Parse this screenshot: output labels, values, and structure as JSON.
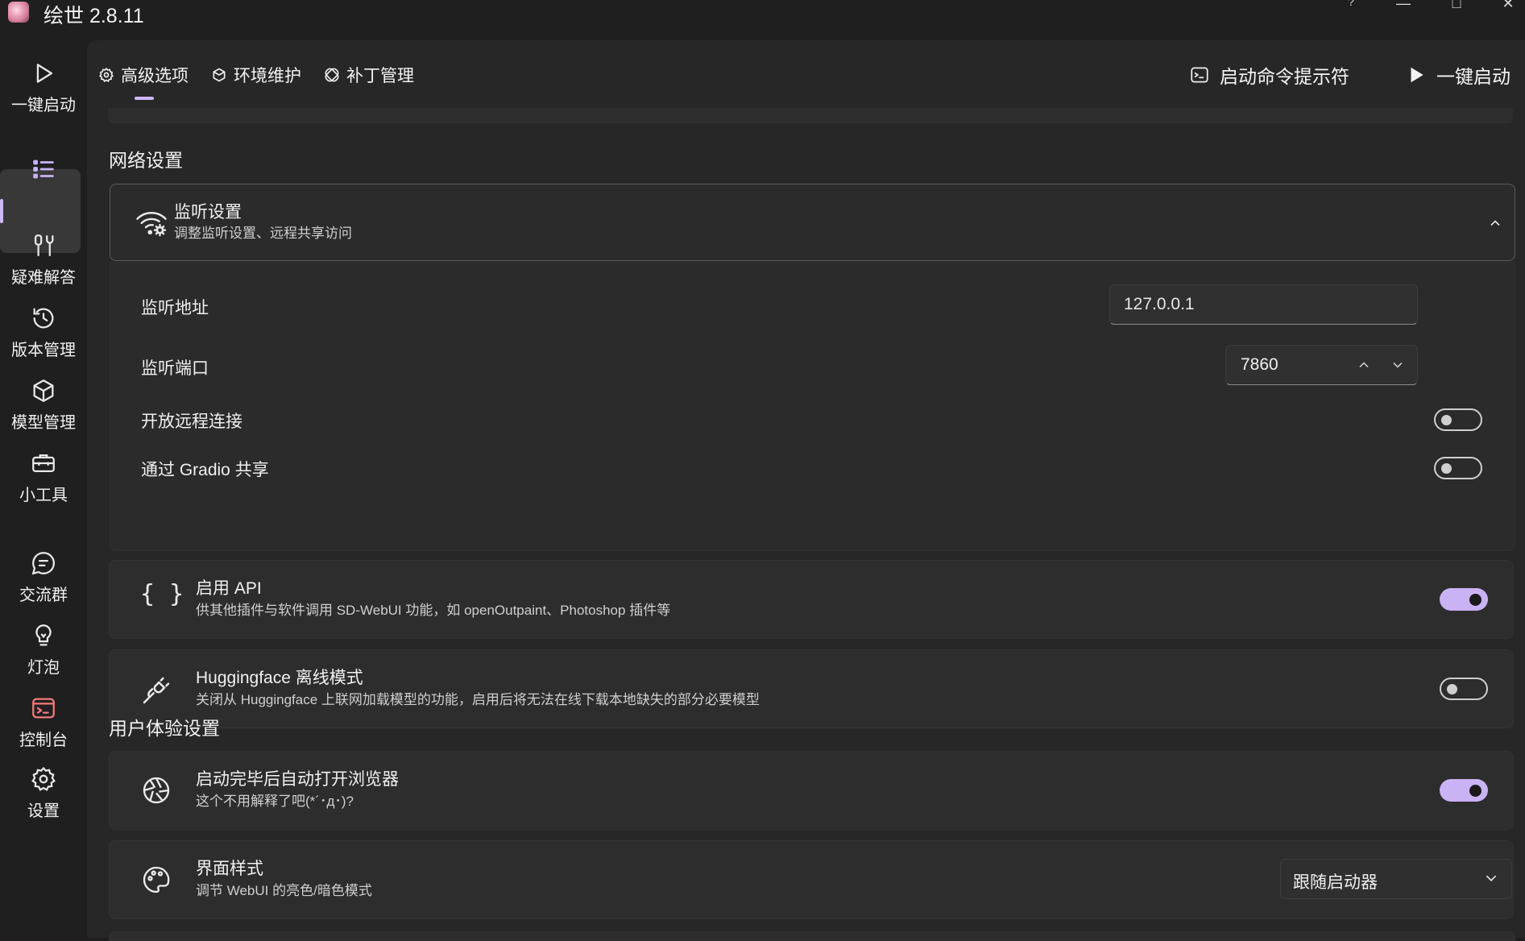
{
  "window": {
    "title": "绘世 2.8.11",
    "help": "?",
    "minimize": "—",
    "maximize": "□",
    "close": "✕"
  },
  "sidebar": {
    "items": [
      {
        "label": "一键启动",
        "icon": "play-icon"
      },
      {
        "label": "",
        "icon": "list-icon"
      },
      {
        "label": "疑难解答",
        "icon": "wrench-icon"
      },
      {
        "label": "版本管理",
        "icon": "history-icon"
      },
      {
        "label": "模型管理",
        "icon": "cube-icon"
      },
      {
        "label": "小工具",
        "icon": "toolbox-icon"
      },
      {
        "label": "交流群",
        "icon": "chat-icon"
      },
      {
        "label": "灯泡",
        "icon": "bulb-icon"
      },
      {
        "label": "控制台",
        "icon": "console-icon"
      },
      {
        "label": "设置",
        "icon": "gear-icon"
      }
    ]
  },
  "topbar": {
    "tabs": [
      {
        "label": "高级选项",
        "icon": "gear-icon"
      },
      {
        "label": "环境维护",
        "icon": "package-icon"
      },
      {
        "label": "补丁管理",
        "icon": "patch-icon"
      }
    ],
    "console_label": "启动命令提示符",
    "launch_label": "一键启动"
  },
  "network": {
    "section_title": "网络设置",
    "listen": {
      "title": "监听设置",
      "desc": "调整监听设置、远程共享访问",
      "address_label": "监听地址",
      "address_value": "127.0.0.1",
      "port_label": "监听端口",
      "port_value": "7860",
      "remote_label": "开放远程连接",
      "remote_on": false,
      "gradio_label": "通过 Gradio 共享",
      "gradio_on": false
    },
    "api": {
      "title": "启用 API",
      "desc": "供其他插件与软件调用 SD-WebUI 功能，如 openOutpaint、Photoshop 插件等",
      "on": true
    },
    "hf": {
      "title": "Huggingface 离线模式",
      "desc": "关闭从 Huggingface 上联网加载模型的功能，启用后将无法在线下载本地缺失的部分必要模型",
      "on": false
    }
  },
  "ux": {
    "section_title": "用户体验设置",
    "browser": {
      "title": "启动完毕后自动打开浏览器",
      "desc": "这个不用解释了吧(*´･д･)?",
      "on": true
    },
    "theme": {
      "title": "界面样式",
      "desc": "调节 WebUI 的亮色/暗色模式",
      "value": "跟随启动器"
    }
  },
  "colors": {
    "accent": "#c9b3f5",
    "bg": "#1f1f1f",
    "card": "#2d2d2d"
  }
}
